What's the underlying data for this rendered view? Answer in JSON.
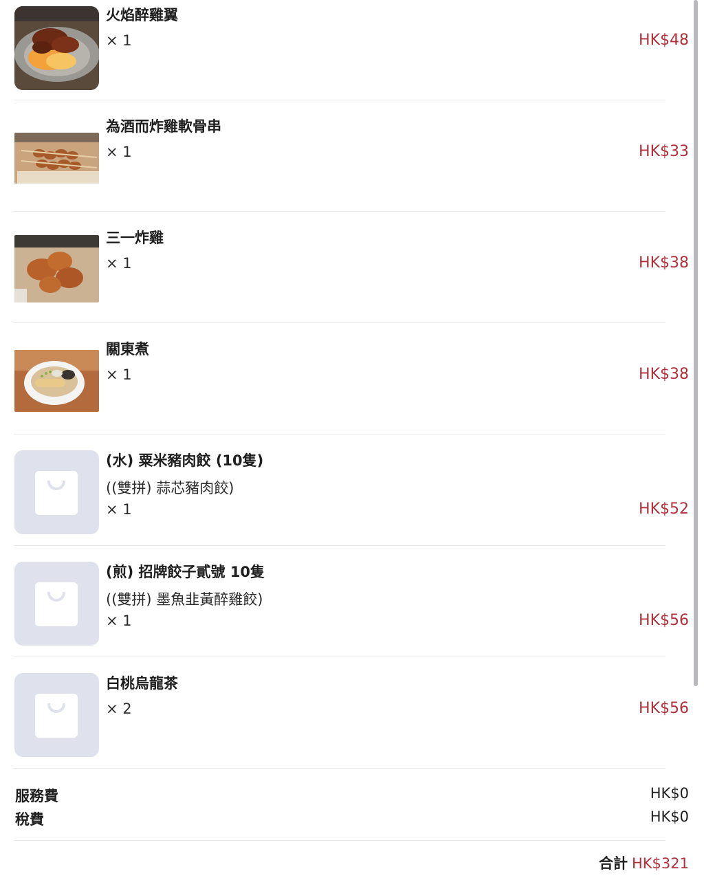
{
  "currency_color": "#b0303b",
  "items": [
    {
      "name": "火焰醉雞翼",
      "option": "",
      "qty": "× 1",
      "price": "HK$48",
      "thumb": "photo-flaming-wings"
    },
    {
      "name": "為酒而炸雞軟骨串",
      "option": "",
      "qty": "× 1",
      "price": "HK$33",
      "thumb": "photo-cartilage-skewers"
    },
    {
      "name": "三一炸雞",
      "option": "",
      "qty": "× 1",
      "price": "HK$38",
      "thumb": "photo-fried-chicken"
    },
    {
      "name": "關東煮",
      "option": "",
      "qty": "× 1",
      "price": "HK$38",
      "thumb": "photo-oden"
    },
    {
      "name": "(水) 粟米豬肉餃 (10隻)",
      "option": "((雙拼) 蒜芯豬肉餃)",
      "qty": "× 1",
      "price": "HK$52",
      "thumb": "shopping-bag-icon"
    },
    {
      "name": "(煎) 招牌餃子貳號 10隻",
      "option": "((雙拼) 墨魚韭黃醉雞餃)",
      "qty": "× 1",
      "price": "HK$56",
      "thumb": "shopping-bag-icon"
    },
    {
      "name": "白桃烏龍茶",
      "option": "",
      "qty": "× 2",
      "price": "HK$56",
      "thumb": "shopping-bag-icon"
    }
  ],
  "summary": {
    "service_label": "服務費",
    "service_value": "HK$0",
    "tax_label": "稅費",
    "tax_value": "HK$0",
    "total_label": "合計",
    "total_value": "HK$321"
  }
}
